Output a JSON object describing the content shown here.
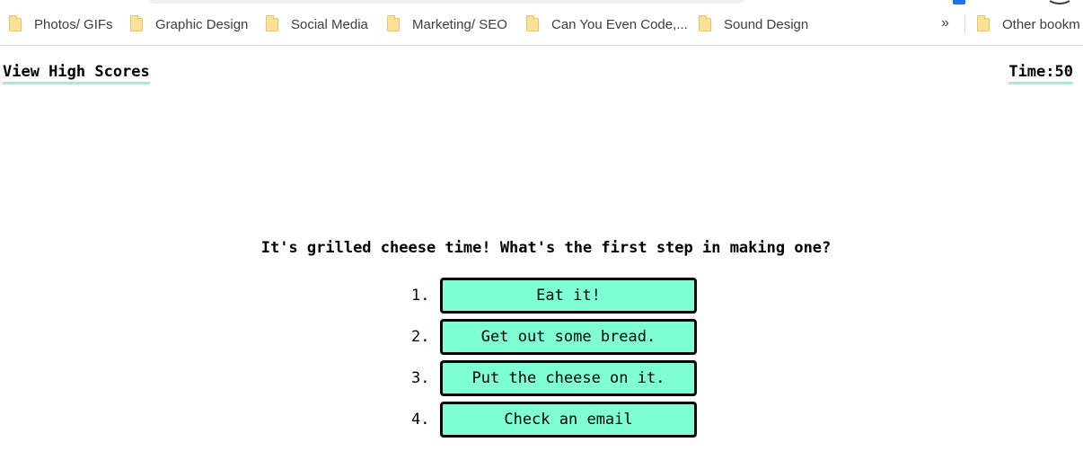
{
  "bookmarks_bar": {
    "items": [
      {
        "label": "Photos/ GIFs"
      },
      {
        "label": "Graphic Design"
      },
      {
        "label": "Social Media"
      },
      {
        "label": "Marketing/ SEO"
      },
      {
        "label": "Can You Even Code,..."
      },
      {
        "label": "Sound Design"
      }
    ],
    "overflow_label": "»",
    "other_bookmarks": "Other bookm",
    "folder_icon": "folder-icon",
    "folder_color": "#fde293"
  },
  "header": {
    "high_scores_label": "View High Scores",
    "timer_label": "Time:",
    "timer_value": "50"
  },
  "quiz": {
    "question": "It's grilled cheese time! What's the first step in making one?",
    "answers": [
      {
        "number": "1.",
        "label": "Eat it!"
      },
      {
        "number": "2.",
        "label": "Get out some bread."
      },
      {
        "number": "3.",
        "label": "Put the cheese on it."
      },
      {
        "number": "4.",
        "label": "Check an email"
      }
    ]
  },
  "colors": {
    "answer_button_bg": "#7fffd4",
    "link_underline": "#9ff0d8"
  }
}
